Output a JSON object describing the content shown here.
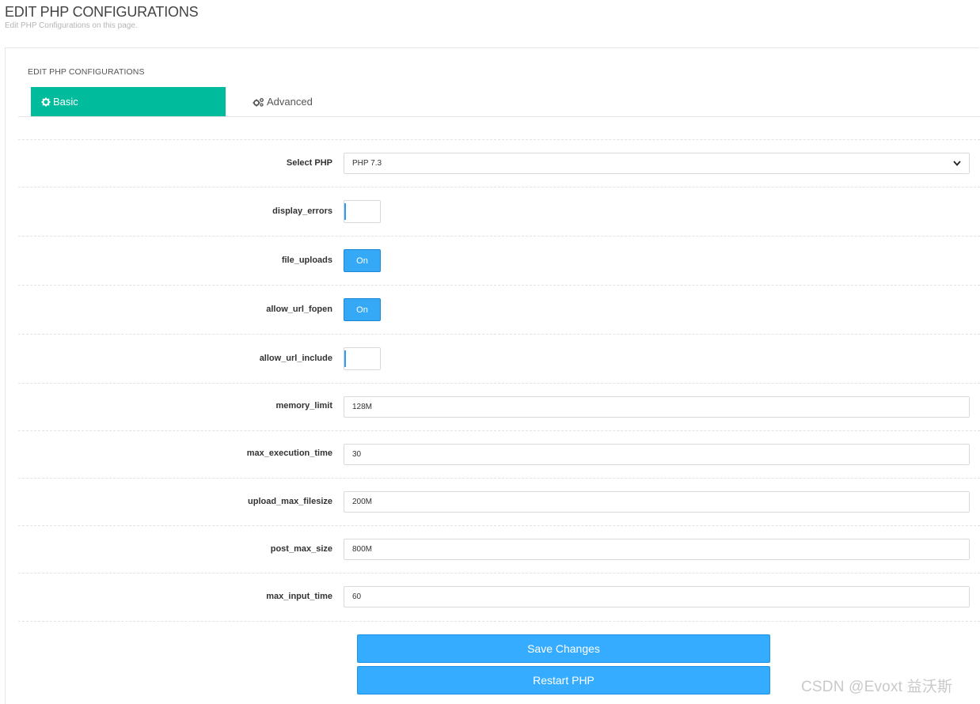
{
  "header": {
    "title": "EDIT PHP CONFIGURATIONS",
    "subtitle": "Edit PHP Configurations on this page."
  },
  "card": {
    "title": "EDIT PHP CONFIGURATIONS",
    "tabs": [
      {
        "label": "Basic",
        "icon": "gear-icon",
        "active": true
      },
      {
        "label": "Advanced",
        "icon": "gears-icon",
        "active": false
      }
    ]
  },
  "form": {
    "select_php": {
      "label": "Select PHP",
      "value": "PHP 7.3"
    },
    "display_errors": {
      "label": "display_errors",
      "state": "off",
      "text": ""
    },
    "file_uploads": {
      "label": "file_uploads",
      "state": "on",
      "text": "On"
    },
    "allow_url_fopen": {
      "label": "allow_url_fopen",
      "state": "on",
      "text": "On"
    },
    "allow_url_include": {
      "label": "allow_url_include",
      "state": "off",
      "text": ""
    },
    "memory_limit": {
      "label": "memory_limit",
      "value": "128M"
    },
    "max_execution_time": {
      "label": "max_execution_time",
      "value": "30"
    },
    "upload_max_filesize": {
      "label": "upload_max_filesize",
      "value": "200M"
    },
    "post_max_size": {
      "label": "post_max_size",
      "value": "800M"
    },
    "max_input_time": {
      "label": "max_input_time",
      "value": "60"
    }
  },
  "actions": {
    "save_label": "Save Changes",
    "restart_label": "Restart PHP"
  },
  "watermark": "CSDN @Evoxt 益沃斯",
  "colors": {
    "tab_active": "#00bb9c",
    "button_blue": "#35acff",
    "toggle_on": "#35a9f5"
  }
}
